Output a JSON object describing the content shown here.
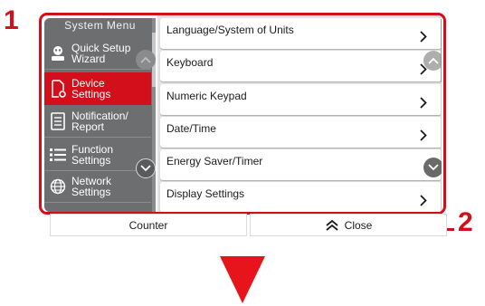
{
  "callouts": {
    "first": "1",
    "second": "2"
  },
  "sidebar": {
    "title": "System Menu",
    "items": [
      {
        "line1": "Quick Setup",
        "line2": "Wizard",
        "icon": "wizard-icon",
        "active": false
      },
      {
        "line1": "Device",
        "line2": "Settings",
        "icon": "device-settings-icon",
        "active": true
      },
      {
        "line1": "Notification/",
        "line2": "Report",
        "icon": "report-icon",
        "active": false
      },
      {
        "line1": "Function",
        "line2": "Settings",
        "icon": "function-list-icon",
        "active": false
      },
      {
        "line1": "Network",
        "line2": "Settings",
        "icon": "network-globe-icon",
        "active": false
      }
    ]
  },
  "menu": {
    "items": [
      "Language/System of Units",
      "Keyboard",
      "Numeric Keypad",
      "Date/Time",
      "Energy Saver/Timer",
      "Display Settings"
    ]
  },
  "bottom": {
    "counter_label": "Counter",
    "close_label": "Close"
  },
  "colors": {
    "accent": "#d40f1c",
    "sidebar_bg": "#6d6e70",
    "list_bg": "#e3e3e3"
  }
}
